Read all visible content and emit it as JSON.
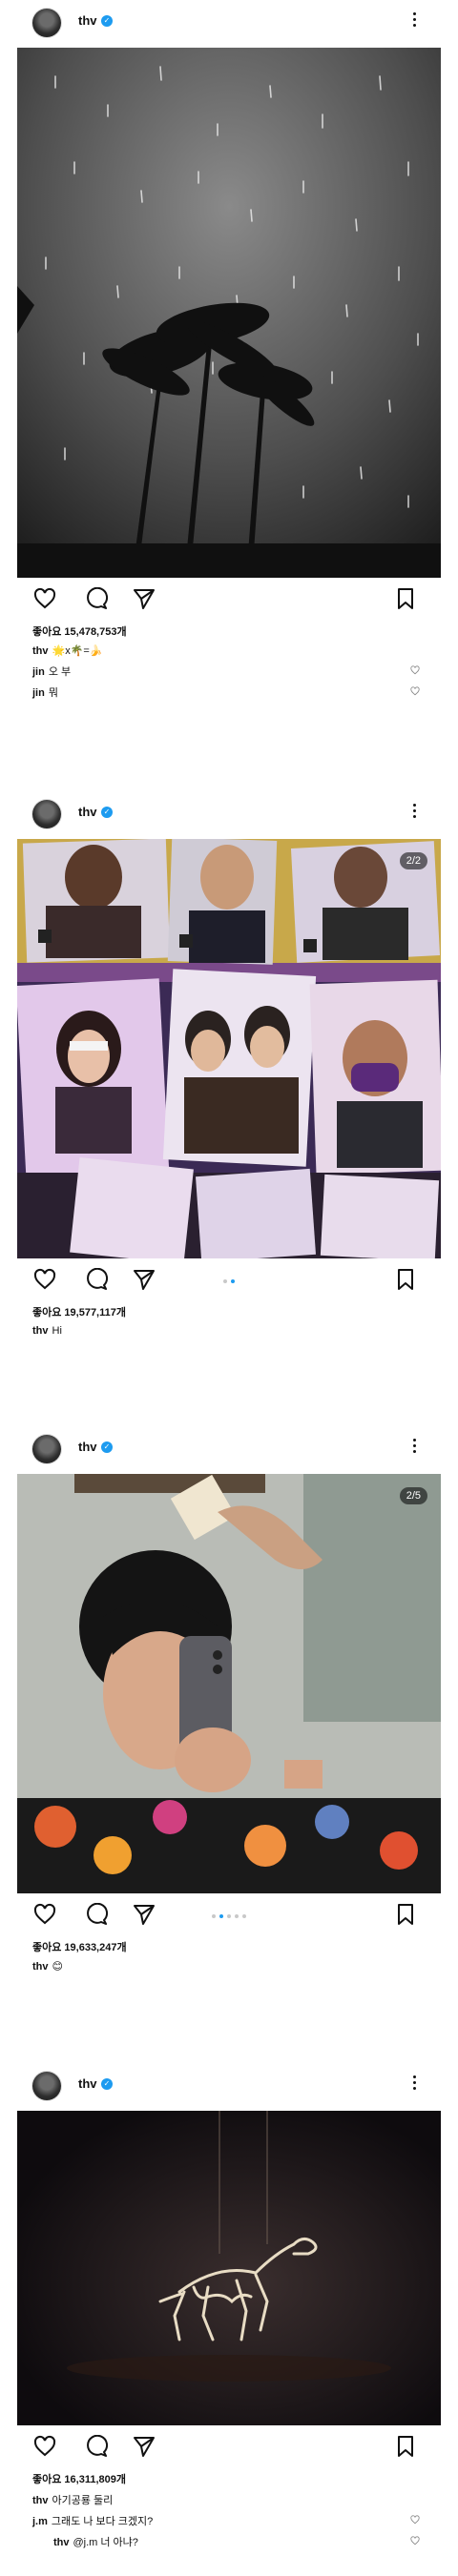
{
  "user": {
    "name": "thv"
  },
  "posts": [
    {
      "likes": "좋아요 15,478,753개",
      "comments": [
        {
          "user": "thv",
          "text": "🌟x🌴=🍌"
        },
        {
          "user": "jin",
          "text": "오 부"
        },
        {
          "user": "jin",
          "text": "뭐"
        }
      ]
    },
    {
      "counter": "2/2",
      "likes": "좋아요 19,577,117개",
      "comments": [
        {
          "user": "thv",
          "text": "Hi"
        }
      ]
    },
    {
      "counter": "2/5",
      "likes": "좋아요 19,633,247개",
      "comments": [
        {
          "user": "thv",
          "text": "😊"
        }
      ]
    },
    {
      "likes": "좋아요 16,311,809개",
      "comments": [
        {
          "user": "thv",
          "text": "아기공룡 둘리"
        },
        {
          "user": "j.m",
          "text": "그래도 나 보다 크겠지?"
        },
        {
          "user": "thv",
          "text": "@j.m 너 아냐?"
        }
      ]
    }
  ],
  "icons": [
    "more-icon",
    "heart-icon",
    "comment-icon",
    "share-icon",
    "bookmark-icon",
    "verified-icon"
  ],
  "colors": {
    "verified": "#1d9bf0",
    "text": "#111111"
  }
}
